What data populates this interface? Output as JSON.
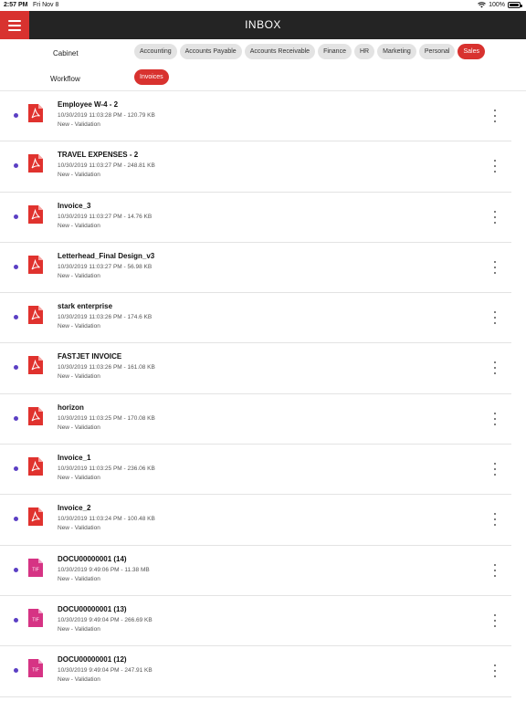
{
  "status_bar": {
    "time": "2:57 PM",
    "date": "Fri Nov 8",
    "battery": "100%"
  },
  "header": {
    "title": "INBOX"
  },
  "filters": {
    "cabinet_label": "Cabinet",
    "workflow_label": "Workflow",
    "cabinets": [
      {
        "label": "Accounting",
        "active": false
      },
      {
        "label": "Accounts Payable",
        "active": false
      },
      {
        "label": "Accounts Receivable",
        "active": false
      },
      {
        "label": "Finance",
        "active": false
      },
      {
        "label": "HR",
        "active": false
      },
      {
        "label": "Marketing",
        "active": false
      },
      {
        "label": "Personal",
        "active": false
      },
      {
        "label": "Sales",
        "active": true
      }
    ],
    "workflows": [
      {
        "label": "Invoices",
        "active": true
      }
    ]
  },
  "documents": [
    {
      "name": "Employee W-4 - 2",
      "meta": "10/30/2019 11:03:28 PM - 120.79 KB",
      "status": "New - Validation",
      "type": "pdf"
    },
    {
      "name": "TRAVEL EXPENSES - 2",
      "meta": "10/30/2019 11:03:27 PM - 248.81 KB",
      "status": "New - Validation",
      "type": "pdf"
    },
    {
      "name": "Invoice_3",
      "meta": "10/30/2019 11:03:27 PM - 14.76 KB",
      "status": "New - Validation",
      "type": "pdf"
    },
    {
      "name": "Letterhead_Final Design_v3",
      "meta": "10/30/2019 11:03:27 PM - 56.98 KB",
      "status": "New - Validation",
      "type": "pdf"
    },
    {
      "name": "stark enterprise",
      "meta": "10/30/2019 11:03:26 PM - 174.6 KB",
      "status": "New - Validation",
      "type": "pdf"
    },
    {
      "name": "FASTJET INVOICE",
      "meta": "10/30/2019 11:03:26 PM - 161.08 KB",
      "status": "New - Validation",
      "type": "pdf"
    },
    {
      "name": "horizon",
      "meta": "10/30/2019 11:03:25 PM - 170.08 KB",
      "status": "New - Validation",
      "type": "pdf"
    },
    {
      "name": "Invoice_1",
      "meta": "10/30/2019 11:03:25 PM - 236.06 KB",
      "status": "New - Validation",
      "type": "pdf"
    },
    {
      "name": "Invoice_2",
      "meta": "10/30/2019 11:03:24 PM - 100.48 KB",
      "status": "New - Validation",
      "type": "pdf"
    },
    {
      "name": "DOCU00000001 (14)",
      "meta": "10/30/2019 9:49:06 PM - 11.38 MB",
      "status": "New - Validation",
      "type": "tif"
    },
    {
      "name": "DOCU00000001 (13)",
      "meta": "10/30/2019 9:49:04 PM - 266.69 KB",
      "status": "New - Validation",
      "type": "tif"
    },
    {
      "name": "DOCU00000001 (12)",
      "meta": "10/30/2019 9:49:04 PM - 247.91 KB",
      "status": "New - Validation",
      "type": "tif"
    }
  ],
  "icons": {
    "pdf_color": "#e0322e",
    "tif_color": "#d63384",
    "accent": "#d8322f",
    "unread_dot": "#5b3fc4",
    "tif_label": "TIF"
  }
}
